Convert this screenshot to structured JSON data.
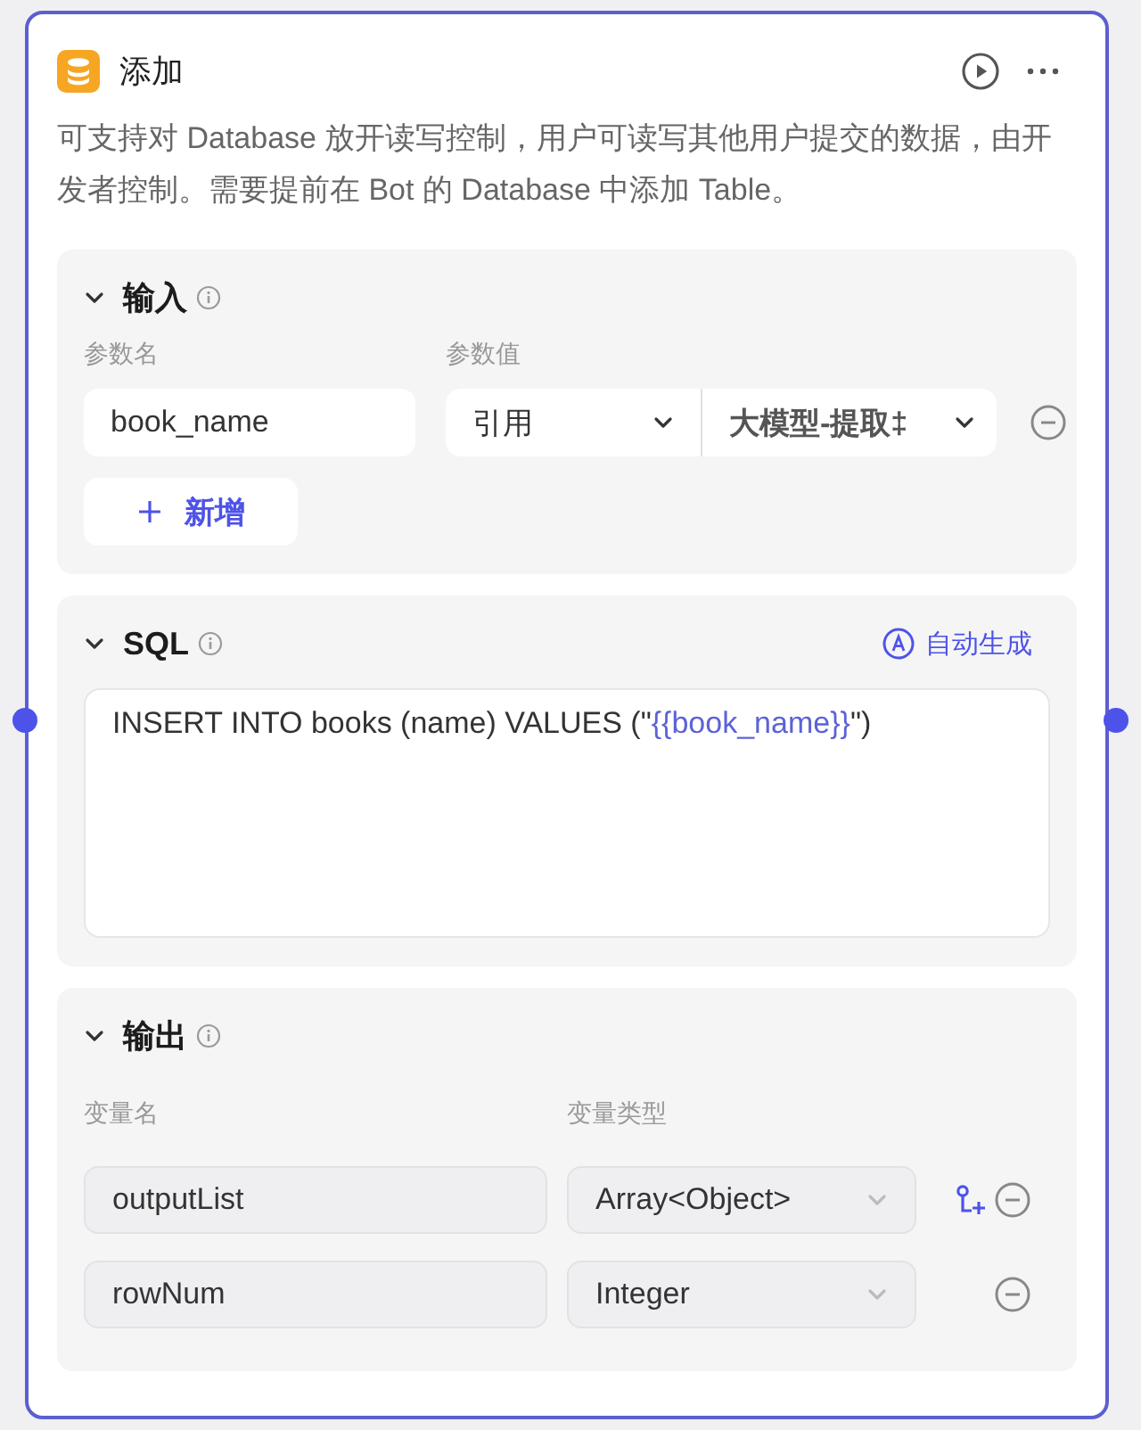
{
  "node": {
    "title": "添加",
    "description": "可支持对 Database 放开读写控制，用户可读写其他用户提交的数据，由开发者控制。需要提前在 Bot 的 Database 中添加 Table。"
  },
  "input": {
    "title": "输入",
    "expanded": true,
    "columns": [
      "参数名",
      "参数值"
    ],
    "rows": [
      {
        "name": "book_name",
        "source": "引用",
        "value": "大模型-提取‡"
      }
    ],
    "add_button": "新增"
  },
  "sql": {
    "title": "SQL",
    "expanded": true,
    "auto_button": "自动生成",
    "parts": [
      {
        "kind": "plain",
        "text": "INSERT INTO books (name) VALUES (\""
      },
      {
        "kind": "variable",
        "text": "{{book_name}}"
      },
      {
        "kind": "plain",
        "text": "\")"
      }
    ]
  },
  "output": {
    "title": "输出",
    "expanded": true,
    "columns": [
      "变量名",
      "变量类型"
    ],
    "rows": [
      {
        "name": "outputList",
        "type": "Array<Object>",
        "disabled": true,
        "has_children_button": true
      },
      {
        "name": "rowNum",
        "type": "Integer",
        "disabled": true,
        "has_children_button": false
      }
    ]
  }
}
